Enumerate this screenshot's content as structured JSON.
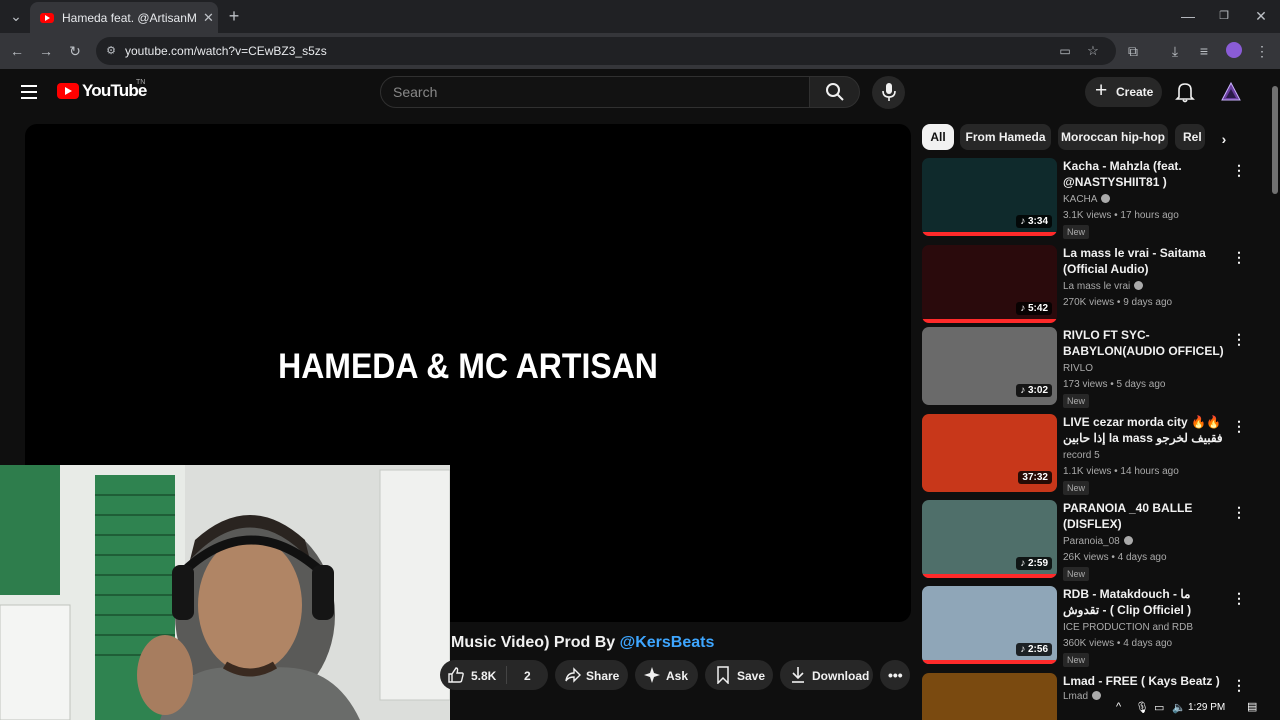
{
  "browser": {
    "tab_title": "Hameda feat. @ArtisanMc - We",
    "url": "youtube.com/watch?v=CEwBZ3_s5zs"
  },
  "youtube": {
    "logo_text": "YouTube",
    "logo_superscript": "TN",
    "search_placeholder": "Search",
    "create_label": "Create"
  },
  "player": {
    "overlay_text": "HAMEDA & MC ARTISAN"
  },
  "video": {
    "title_prefix": "Music Video) Prod By ",
    "title_link": "@KersBeats",
    "likes": "5.8K",
    "comments_count": "2",
    "share_label": "Share",
    "ask_label": "Ask",
    "save_label": "Save",
    "download_label": "Download"
  },
  "chips": [
    "All",
    "From Hameda",
    "Moroccan hip-hop",
    "Rel"
  ],
  "recommendations": [
    {
      "title": "Kacha - Mahzla (feat. @NASTYSHIIT81 )",
      "channel": "KACHA",
      "verified": true,
      "meta": "3.1K views • 17 hours ago",
      "badge": "New",
      "duration": "3:34",
      "thumb_color": "#0f2a2c"
    },
    {
      "title": "La mass le vrai - Saitama (Official Audio)",
      "channel": "La mass le vrai",
      "verified": true,
      "meta": "270K views • 9 days ago",
      "badge": "",
      "duration": "5:42",
      "thumb_color": "#2a0a0c"
    },
    {
      "title": "RIVLO FT SYC-BABYLON(AUDIO OFFICEL)",
      "channel": "RIVLO",
      "verified": false,
      "meta": "173 views • 5 days ago",
      "badge": "New",
      "duration": "3:02",
      "thumb_color": "#6a6a6a"
    },
    {
      "title": "LIVE cezar morda city 🔥🔥 إذا حابين la mass فقبيف لخرجو لنا مستوى...",
      "channel": "record 5",
      "verified": false,
      "meta": "1.1K views • 14 hours ago",
      "badge": "New",
      "duration": "37:32",
      "thumb_color": "#c8371a"
    },
    {
      "title": "PARANOIA _40 BALLE (DISFLEX)",
      "channel": "Paranoia_08",
      "verified": true,
      "meta": "26K views • 4 days ago",
      "badge": "New",
      "duration": "2:59",
      "thumb_color": "#4f6f6a"
    },
    {
      "title": "RDB - Matakdouch - ما تقدوش - ( Clip Officiel )",
      "channel": "ICE PRODUCTION and RDB",
      "verified": false,
      "meta": "360K views • 4 days ago",
      "badge": "New",
      "duration": "2:56",
      "thumb_color": "#8fa6b8"
    },
    {
      "title": "Lmad - FREE  ( Kays Beatz )",
      "channel": "Lmad",
      "verified": true,
      "meta": "",
      "badge": "",
      "duration": "",
      "thumb_color": "#7a4a10"
    }
  ],
  "taskbar": {
    "time": "1:29 PM"
  }
}
